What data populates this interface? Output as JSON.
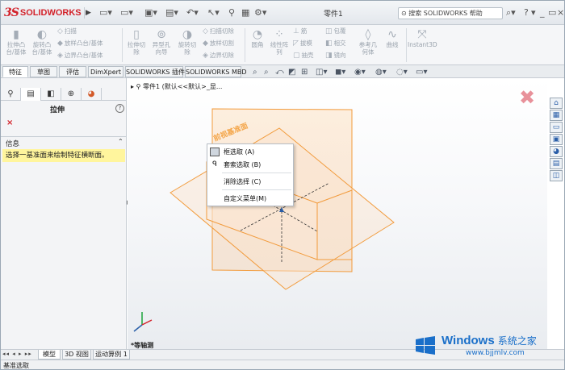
{
  "app": {
    "logo_prefix": "3S",
    "logo_text": "SOLIDWORKS",
    "doc_title": "零件1",
    "search_text": "搜索 SOLIDWORKS 帮助",
    "help_glyph": "?"
  },
  "ribbon": {
    "big_buttons": [
      {
        "label": "拉伸凸\n台/基体",
        "icon": "extrude-boss-icon"
      },
      {
        "label": "旋转凸\n台/基体",
        "icon": "revolve-boss-icon"
      },
      {
        "label": "拉伸切\n除",
        "icon": "extrude-cut-icon"
      },
      {
        "label": "异型孔\n向导",
        "icon": "hole-wizard-icon"
      },
      {
        "label": "旋转切\n除",
        "icon": "revolve-cut-icon"
      },
      {
        "label": "圆角",
        "icon": "fillet-icon"
      },
      {
        "label": "线性阵\n列",
        "icon": "linear-pattern-icon"
      },
      {
        "label": "参考几\n何体",
        "icon": "reference-geometry-icon"
      },
      {
        "label": "曲线",
        "icon": "curves-icon"
      },
      {
        "label": "Instant3D",
        "icon": "instant3d-icon"
      }
    ],
    "small_group1": [
      "扫描",
      "放样凸台/基体",
      "边界凸台/基体"
    ],
    "small_group2": [
      "扫描切除",
      "放样切割",
      "边界切除"
    ],
    "small_group3": [
      "筋",
      "拔模",
      "抽壳"
    ],
    "small_group4": [
      "包覆",
      "相交",
      "镜向"
    ]
  },
  "command_tabs": [
    "特征",
    "草图",
    "评估",
    "DimXpert",
    "SOLIDWORKS 插件",
    "SOLIDWORKS MBD"
  ],
  "left_panel": {
    "title": "拉伸",
    "help": "?",
    "close": "×",
    "message_header": "信息",
    "message_body": "选择一基准面来绘制特征横断面。"
  },
  "graphics": {
    "tree_flyout": "零件1  (默认<<默认>_显...",
    "plane_label": "前视基准面",
    "iso_label": "*等轴测"
  },
  "context_menu": {
    "items": [
      {
        "label": "框选取 (A)",
        "icon": "box-select-icon"
      },
      {
        "label": "套索选取 (B)",
        "icon": "lasso-select-icon"
      },
      {
        "label": "消除选择 (C)",
        "icon": ""
      },
      {
        "label": "自定义菜单(M)",
        "icon": ""
      }
    ]
  },
  "bottom_tabs": [
    "模型",
    "3D 视图",
    "运动算例 1"
  ],
  "status": "基准选取",
  "watermark": {
    "title": "Windows",
    "subtitle": "系统之家",
    "url": "www.bjjmlv.com"
  },
  "colors": {
    "brand_red": "#d3222a",
    "plane_orange": "#f4a64a",
    "highlight_yellow": "#fff59d",
    "watermark_blue": "#1a6fc9"
  }
}
